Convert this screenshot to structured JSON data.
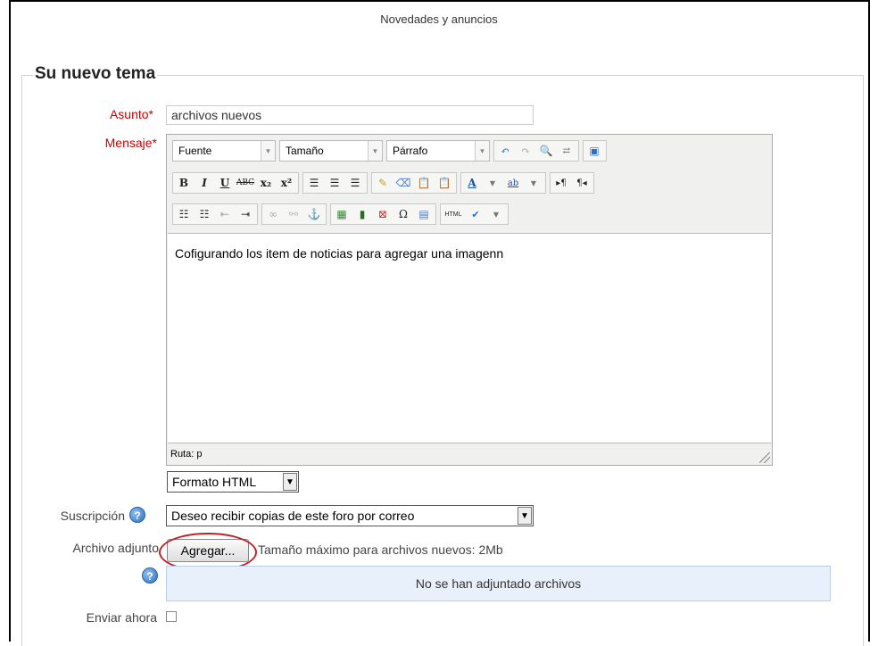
{
  "forum": {
    "title": "Novedades y anuncios"
  },
  "form": {
    "legend": "Su nuevo tema",
    "subject": {
      "label": "Asunto",
      "value": "archivos nuevos"
    },
    "message": {
      "label": "Mensaje",
      "required_mark": "*",
      "toolbar": {
        "font_select": "Fuente",
        "size_select": "Tamaño",
        "format_select": "Párrafo"
      },
      "content": "Cofigurando los item de noticias para agregar una imagenn",
      "path_label": "Ruta: p"
    },
    "format": {
      "value": "Formato HTML"
    },
    "subscription": {
      "label": "Suscripción",
      "value": "Deseo recibir copias de este foro por correo"
    },
    "attachment": {
      "label": "Archivo adjunto",
      "button_label": "Agregar...",
      "max_size_text": "Tamaño máximo para archivos nuevos: 2Mb",
      "empty_text": "No se han adjuntado archivos"
    },
    "send_now": {
      "label": "Enviar ahora",
      "checked": false
    }
  },
  "colors": {
    "required": "#cc0000",
    "annotation": "#c0202a",
    "files_bg": "#e8f1fb"
  }
}
